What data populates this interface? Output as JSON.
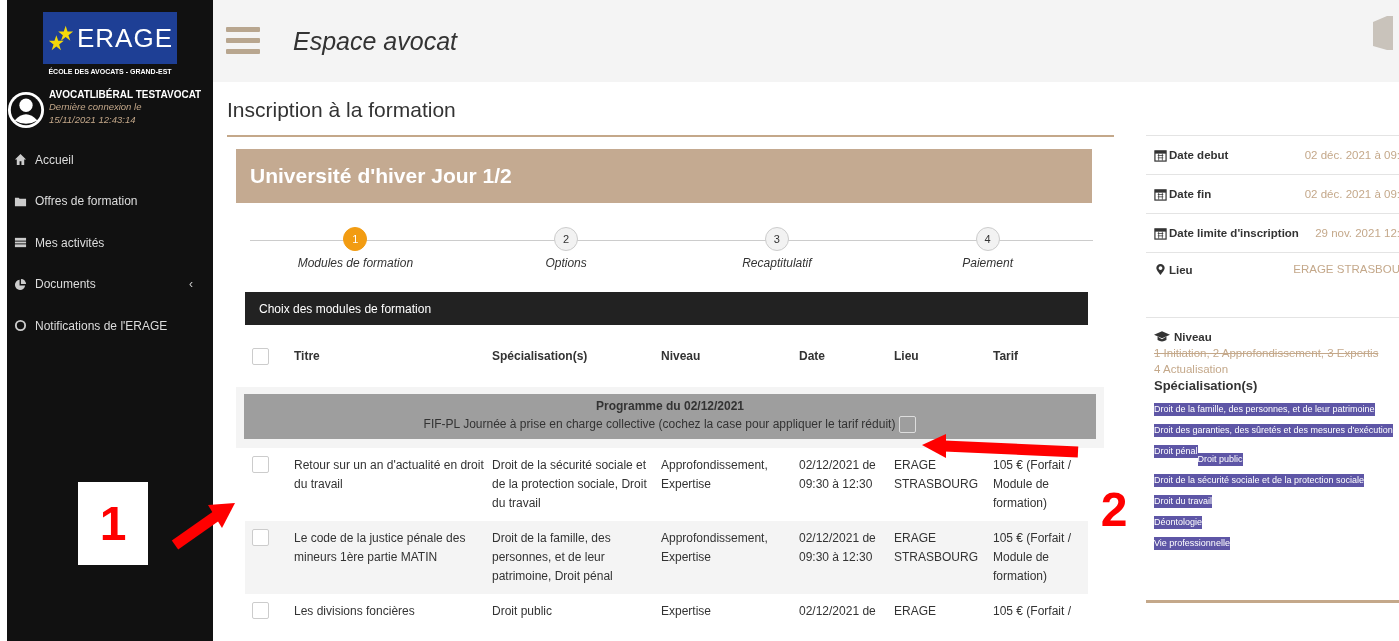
{
  "sidebar": {
    "logo": {
      "text": "ERAGE",
      "subtitle": "ÉCOLE DES AVOCATS - GRAND-EST"
    },
    "user": {
      "name": "AVOCATLIBÉRAL TESTAVOCAT",
      "last_login": "Dernière connexion le 15/11/2021 12:43:14"
    },
    "items": [
      {
        "label": "Accueil",
        "kind": "home"
      },
      {
        "label": "Offres de formation",
        "kind": "folder"
      },
      {
        "label": "Mes activités",
        "kind": "list"
      },
      {
        "label": "Documents",
        "kind": "pie",
        "caret": "‹"
      },
      {
        "label": "Notifications de l'ERAGE",
        "kind": "circle"
      }
    ]
  },
  "header": {
    "title": "Espace avocat"
  },
  "page_title": "Inscription à la formation",
  "banner": "Université d'hiver Jour 1/2",
  "steps": [
    {
      "number": "1",
      "label": "Modules de formation",
      "selected": true
    },
    {
      "number": "2",
      "label": "Options",
      "selected": false
    },
    {
      "number": "3",
      "label": "Recaptitulatif",
      "selected": false
    },
    {
      "number": "4",
      "label": "Paiement",
      "selected": false
    }
  ],
  "section_title": "Choix des modules de formation",
  "table": {
    "select_all_checked": false,
    "columns": [
      "Titre",
      "Spécialisation(s)",
      "Niveau",
      "Date",
      "Lieu",
      "Tarif"
    ],
    "group": {
      "title": "Programme du 02/12/2021",
      "note": "FIF-PL Journée à prise en charge collective (cochez la case pour appliquer le tarif réduit)",
      "checked": false
    },
    "rows": [
      {
        "checked": false,
        "cells": [
          "Retour sur un an d'actualité en droit du travail",
          "Droit de la sécurité sociale et de la protection sociale, Droit du travail",
          "Approfondissement, Expertise",
          "02/12/2021 de 09:30 à 12:30",
          "ERAGE STRASBOURG",
          "105 € (Forfait / Module de formation)"
        ]
      },
      {
        "checked": false,
        "cells": [
          "Le code de la justice pénale des mineurs 1ère partie MATIN",
          "Droit de la famille, des personnes, et de leur patrimoine, Droit pénal",
          "Approfondissement, Expertise",
          "02/12/2021 de 09:30 à 12:30",
          "ERAGE STRASBOURG",
          "105 € (Forfait / Module de formation)"
        ]
      },
      {
        "checked": false,
        "cells": [
          "Les divisions foncières",
          "Droit public",
          "Expertise",
          "02/12/2021 de",
          "ERAGE",
          "105 € (Forfait /"
        ]
      }
    ]
  },
  "details": [
    {
      "kind": "date",
      "label": "Date debut",
      "value": "02 déc. 2021 à 09:"
    },
    {
      "kind": "date",
      "label": "Date fin",
      "value": "02 déc. 2021 à 09:"
    },
    {
      "kind": "date",
      "label": "Date limite d'inscription",
      "value": "29 nov. 2021 12:"
    },
    {
      "kind": "place",
      "label": "Lieu",
      "value": "ERAGE STRASBOU"
    }
  ],
  "niveau": {
    "label": "Niveau",
    "items": [
      {
        "text": "1 Initiation, 2 Approfondissement, 3 Expertis",
        "struck": true
      },
      {
        "text": "4 Actualisation",
        "struck": false
      }
    ]
  },
  "specialisations": {
    "label": "Spécialisation(s)",
    "tags": [
      "Droit de la famille, des personnes, et de leur patrimoine",
      "Droit des garanties, des sûretés et des mesures d'exécution",
      "Droit pénal",
      "Droit public",
      "Droit de la sécurité sociale et de la protection sociale",
      "Droit du travail",
      "Déontologie",
      "Vie professionnelle"
    ]
  },
  "annotations": [
    {
      "label": "1"
    },
    {
      "label": "2"
    }
  ]
}
